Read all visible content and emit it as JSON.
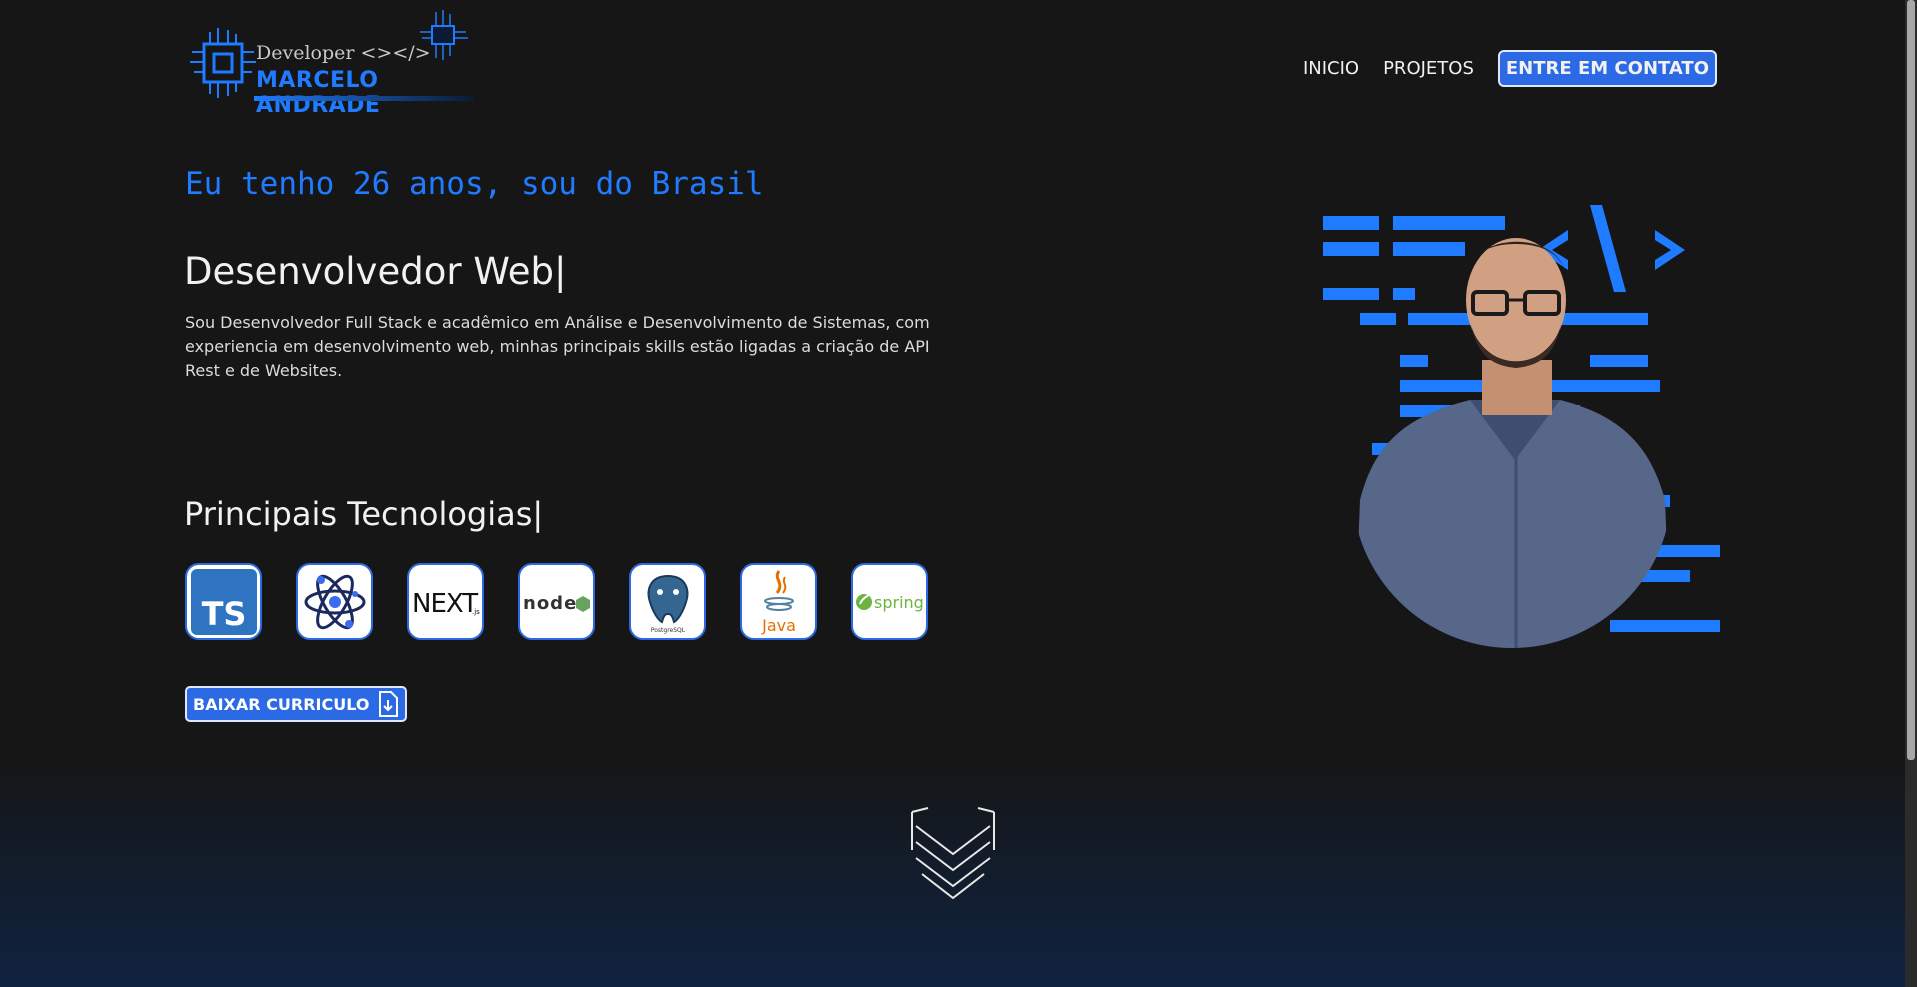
{
  "logo": {
    "subtitle": "Developer <></>",
    "name": "MARCELO ANDRADE"
  },
  "nav": {
    "items": [
      {
        "label": "INICIO"
      },
      {
        "label": "PROJETOS"
      }
    ],
    "cta": "ENTRE EM CONTATO"
  },
  "hero": {
    "age_line": "Eu tenho 26 anos, sou do Brasil",
    "role": "Desenvolvedor Web|",
    "description": "Sou Desenvolvedor Full Stack e acadêmico em Análise e Desenvolvimento de Sistemas, com experiencia em desenvolvimento web, minhas principais skills estão ligadas a criação de API Rest e de Websites.",
    "tech_title": "Principais Tecnologias|",
    "technologies": [
      {
        "name": "TypeScript",
        "icon": "typescript-icon",
        "label": "TS"
      },
      {
        "name": "React",
        "icon": "react-icon"
      },
      {
        "name": "Next.js",
        "icon": "nextjs-icon",
        "label": "NEXT"
      },
      {
        "name": "Node.js",
        "icon": "nodejs-icon",
        "label": "node"
      },
      {
        "name": "PostgreSQL",
        "icon": "postgresql-icon"
      },
      {
        "name": "Java",
        "icon": "java-icon",
        "label": "Java"
      },
      {
        "name": "Spring",
        "icon": "spring-icon",
        "label": "spring"
      }
    ],
    "download_label": "BAIXAR CURRICULO"
  },
  "colors": {
    "accent": "#1f7bff",
    "button": "#2c6ae5",
    "background": "#161617",
    "footer_gradient": "#0f2340"
  }
}
